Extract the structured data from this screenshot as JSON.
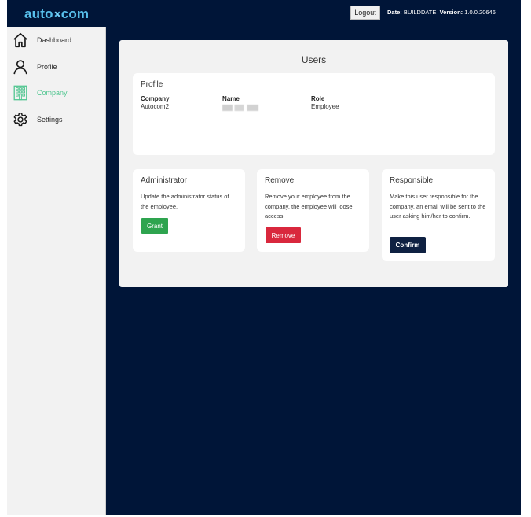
{
  "header": {
    "logo_left": "auto",
    "logo_right": "com",
    "logout_label": "Logout",
    "date_label": "Date:",
    "date_value": "BUILDDATE",
    "version_label": "Version:",
    "version_value": "1.0.0.20646"
  },
  "sidebar": {
    "items": [
      {
        "label": "Dashboard",
        "icon": "home-icon"
      },
      {
        "label": "Profile",
        "icon": "user-icon"
      },
      {
        "label": "Company",
        "icon": "building-icon",
        "active": true
      },
      {
        "label": "Settings",
        "icon": "gear-icon"
      }
    ]
  },
  "main": {
    "title": "Users",
    "profile": {
      "title": "Profile",
      "company_label": "Company",
      "company_value": "Autocom2",
      "name_label": "Name",
      "role_label": "Role",
      "role_value": "Employee"
    },
    "administrator": {
      "title": "Administrator",
      "description": "Update the administrator status of the employee.",
      "button_label": "Grant"
    },
    "remove": {
      "title": "Remove",
      "description": "Remove your employee from the company, the employee will loose access.",
      "button_label": "Remove"
    },
    "responsible": {
      "title": "Responsible",
      "description": "Make this user responsible for the company, an email will be sent to the user asking him/her to confirm.",
      "button_label": "Confirm"
    }
  },
  "colors": {
    "background": "#001538",
    "accent_active": "#4fc58f",
    "grant": "#2ea44f",
    "remove": "#d9283d",
    "confirm": "#0f2142",
    "logo": "#58c0ec"
  }
}
